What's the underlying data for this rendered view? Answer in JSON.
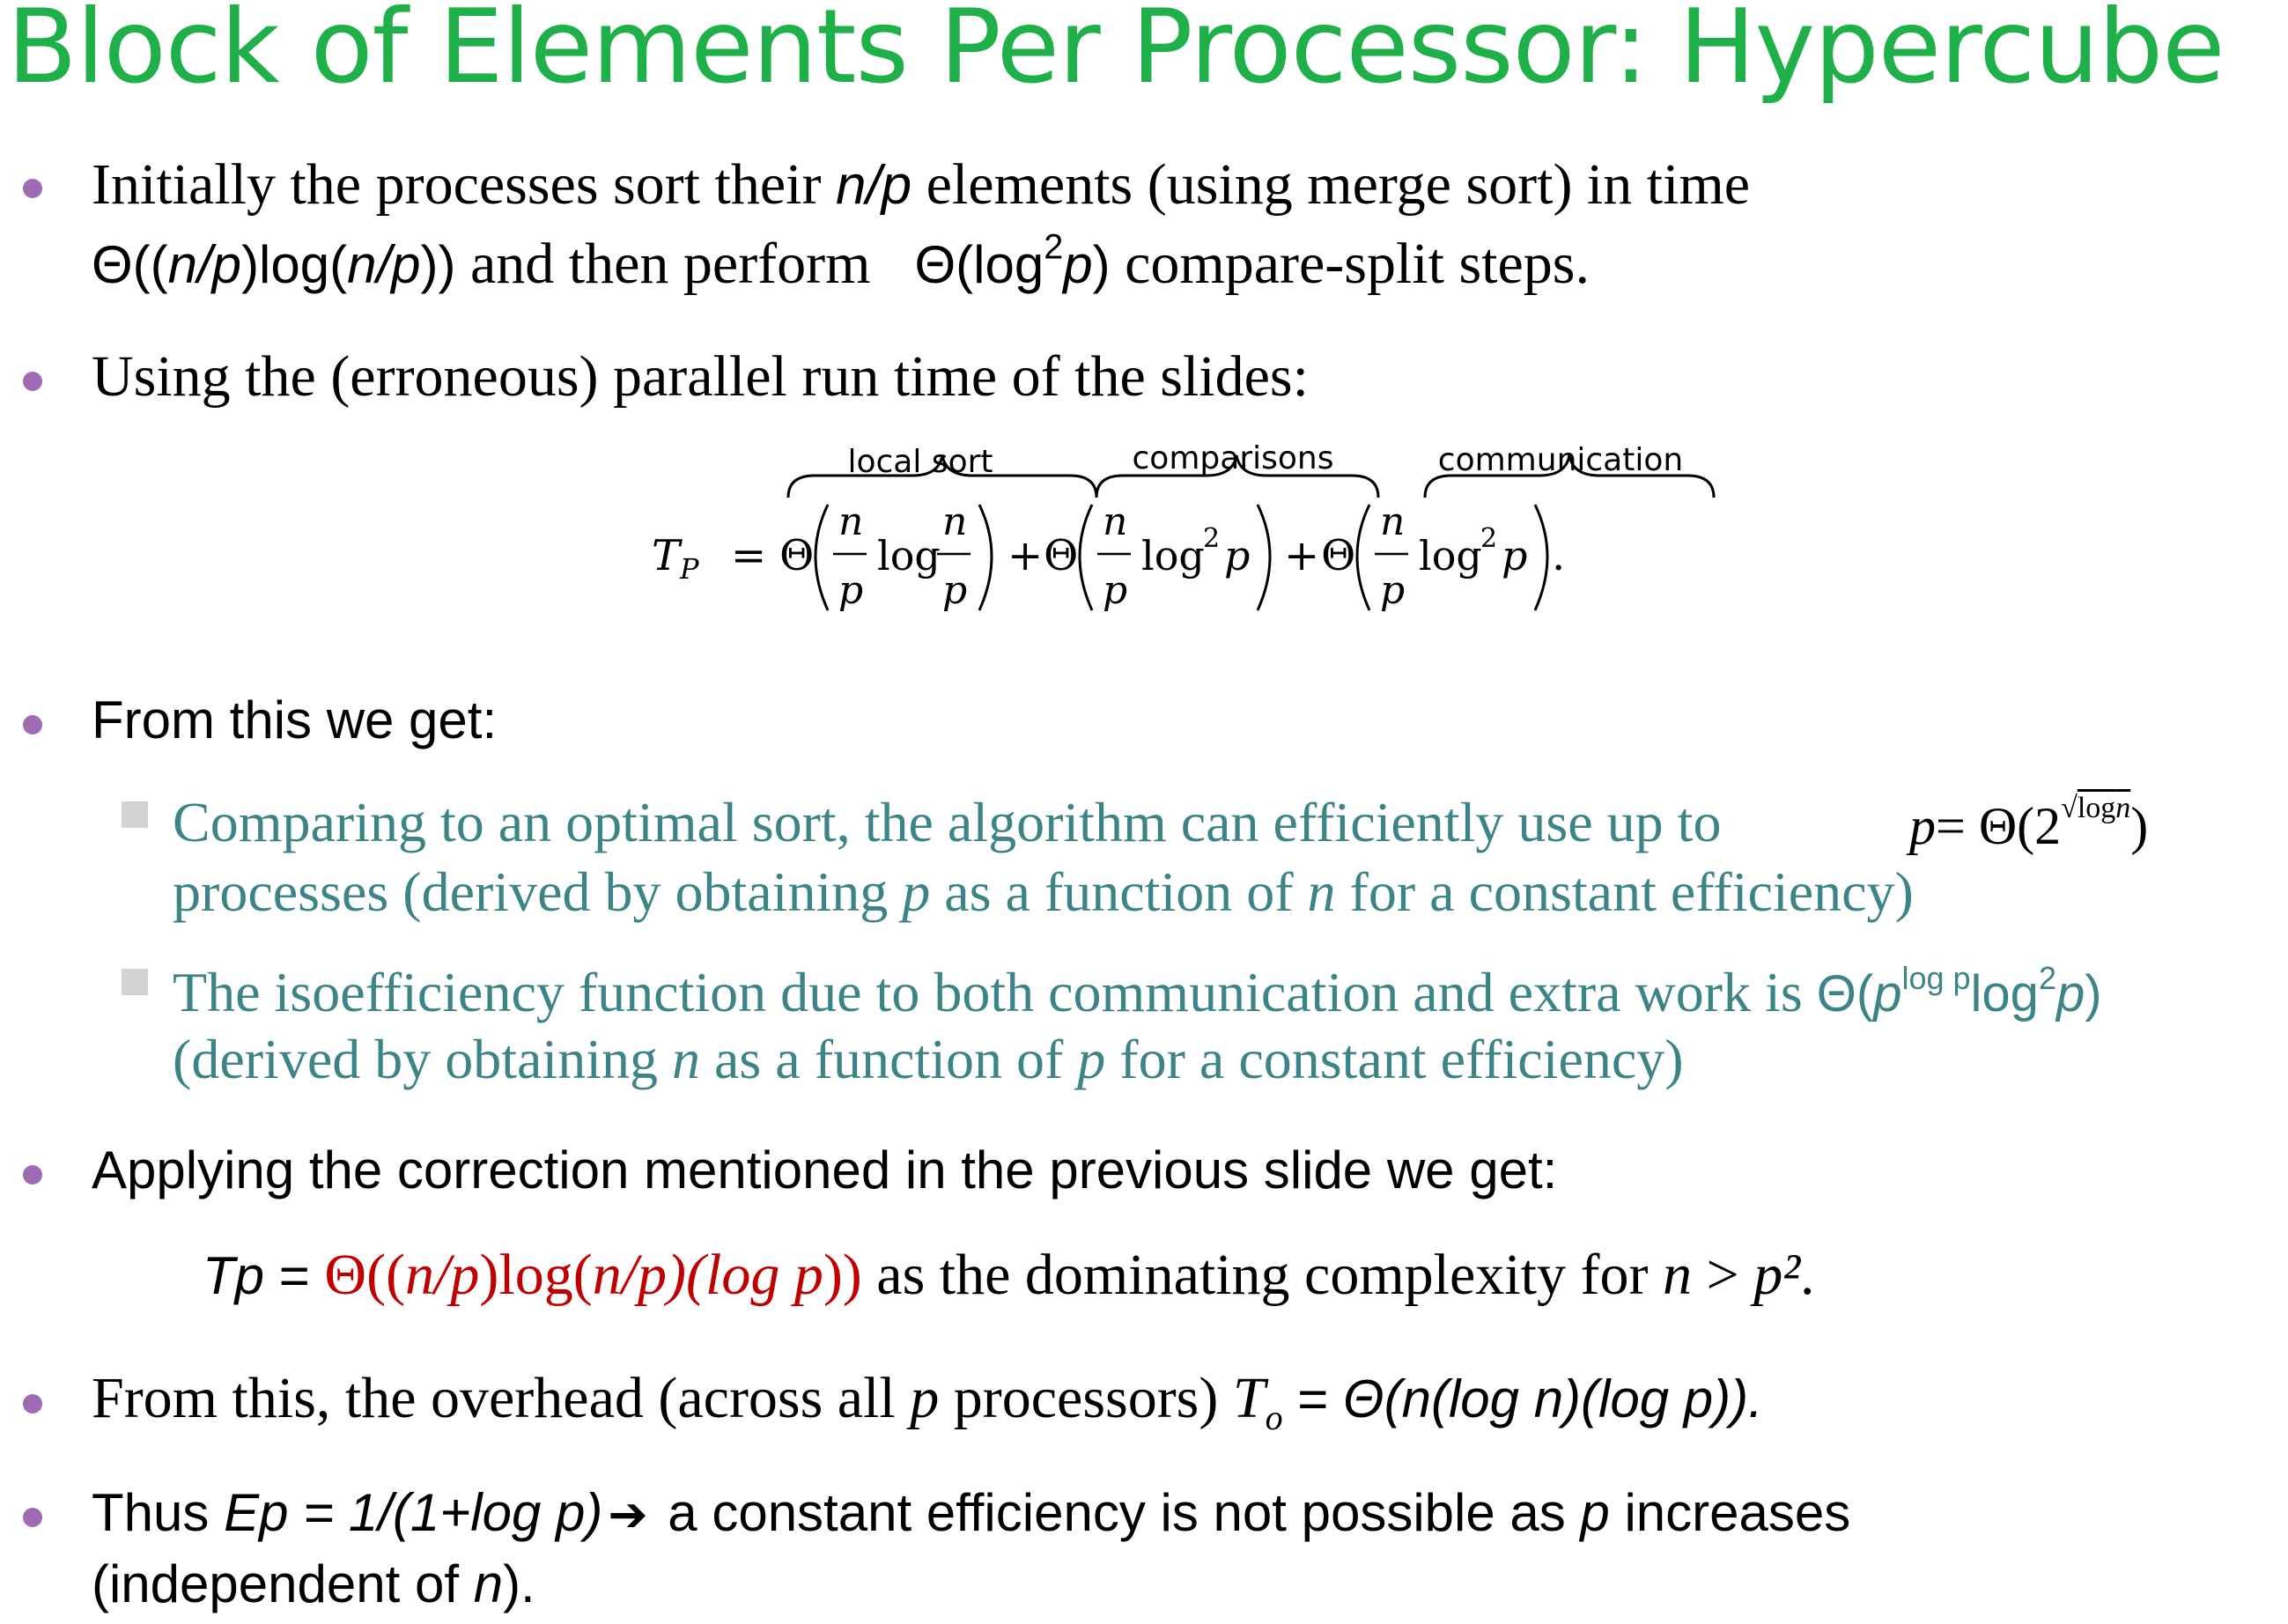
{
  "title": "Block of Elements Per Processor: Hypercube",
  "b1": {
    "l1a": "Initially the processes sort their ",
    "l1b": "n/p",
    "l1c": " elements (using merge sort) in time",
    "l2a": "Θ((",
    "l2b": "n/p",
    "l2c": ")log(",
    "l2d": "n/p",
    "l2e": "))",
    "l2f": " and then perform",
    "l2g": "Θ(log",
    "l2h": "2",
    "l2i": "p",
    "l2j": ")",
    "l2k": " compare-split steps."
  },
  "b2": {
    "text": "Using the (erroneous)  parallel run time of the slides:"
  },
  "equation": {
    "lhs": "T",
    "lhs_sub": "P",
    "equals": "=",
    "theta": "Θ",
    "n": "n",
    "p": "p",
    "log": "log",
    "sq": "2",
    "plus": "+",
    "dot": ".",
    "brace1": "local sort",
    "brace2": "comparisons",
    "brace3": "communication"
  },
  "b3": {
    "text": "From this we get:"
  },
  "sub1": {
    "l1": "Comparing to an optimal sort, the algorithm can efficiently use up to",
    "f_p": "p",
    "f_eq": "= Θ(2",
    "f_rad": "log",
    "f_n": "n",
    "f_close": ")",
    "l2a": "processes (derived by obtaining ",
    "l2b": "p",
    "l2c": " as a function of ",
    "l2d": "n",
    "l2e": " for a constant efficiency)"
  },
  "sub2": {
    "l1": "The isoefficiency function due to both communication and extra work is ",
    "f1": "Θ(",
    "f2": "p",
    "f3": "log p",
    "f4": "log",
    "f5": "2",
    "f6": "p",
    "f7": ")",
    "l2a": "(derived by obtaining ",
    "l2b": "n",
    "l2c": " as a function of ",
    "l2d": "p",
    "l2e": " for a constant efficiency)"
  },
  "b4": {
    "text": "Applying the correction mentioned in the previous slide we get:"
  },
  "tp": {
    "a": "Tp",
    "b": " = ",
    "c": "Θ((",
    "d": "n/p",
    "e": ")log(",
    "f": "n/p)(log p",
    "g": "))",
    "h": " as the dominating complexity for ",
    "i": "n",
    "j": " > ",
    "k": "p²",
    "l": "."
  },
  "b5": {
    "a": "From this, the overhead (across all ",
    "b": "p",
    "c": " processors) ",
    "d": "T",
    "e": "o",
    "f": " = ",
    "g": "Θ(n(log n)(log p))."
  },
  "b6": {
    "a": "Thus ",
    "b": "Ep = 1/(1+log p)",
    "c": "➔",
    "d": " a constant efficiency is not possible as ",
    "e": "p",
    "f": " increases",
    "g": "(independent of ",
    "h": "n",
    "i": ")."
  },
  "colors": {
    "title": "#1fb04a",
    "bullet": "#a06ab4",
    "subtext": "#3c8486",
    "highlight": "#c00000",
    "square_bullet": "#d3d3d3"
  }
}
